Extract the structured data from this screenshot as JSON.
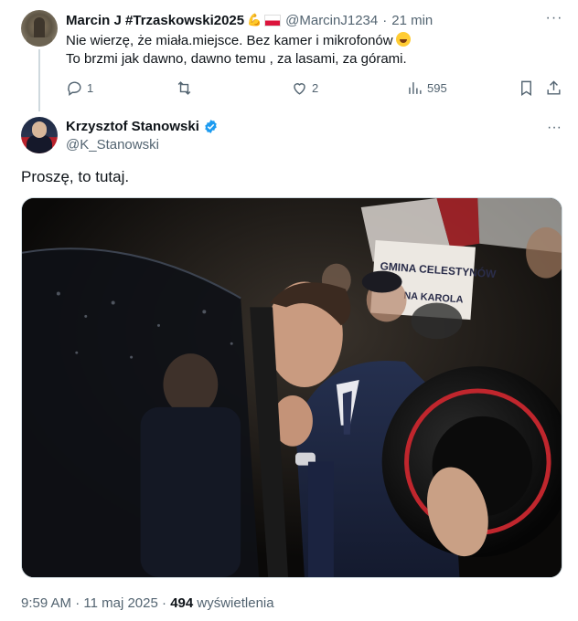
{
  "reply": {
    "author_name": "Marcin J #Trzaskowski2025",
    "author_emoji": "💪",
    "handle": "@MarcinJ1234",
    "dot": "·",
    "time": "21 min",
    "line1": "Nie wierzę, że miała.miejsce. Bez kamer i mikrofonów",
    "line2": "To brzmi jak dawno, dawno temu , za lasami, za górami.",
    "more": "···",
    "actions": {
      "replies": "1",
      "likes": "2",
      "views": "595"
    }
  },
  "post": {
    "author_name": "Krzysztof Stanowski",
    "handle": "@K_Stanowski",
    "more": "···",
    "text": "Proszę, to tutaj.",
    "photo_sign_line1": "GMINA CELESTYNÓW",
    "photo_sign_line2": "NA KAROLA",
    "meta": {
      "time": "9:59 AM",
      "sep1": "·",
      "date": "11 maj 2025",
      "sep2": "·",
      "views": "494",
      "views_label": "wyświetlenia"
    }
  },
  "colors": {
    "text": "#0f1419",
    "secondary": "#536471",
    "verified": "#1d9bf0",
    "divider": "#cfd9de"
  }
}
